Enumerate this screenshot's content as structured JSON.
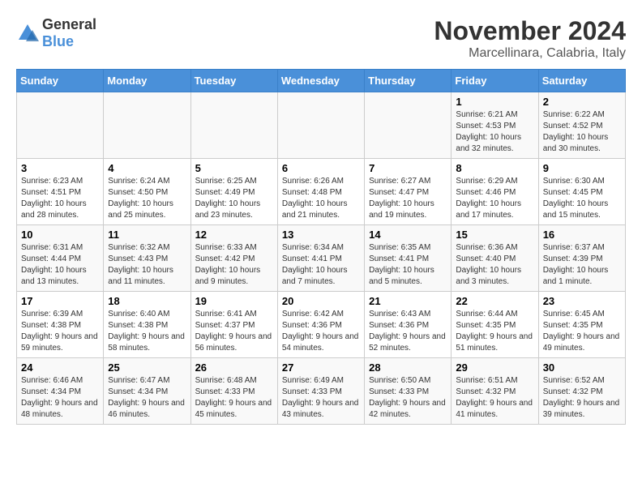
{
  "logo": {
    "general": "General",
    "blue": "Blue"
  },
  "title": "November 2024",
  "subtitle": "Marcellinara, Calabria, Italy",
  "headers": [
    "Sunday",
    "Monday",
    "Tuesday",
    "Wednesday",
    "Thursday",
    "Friday",
    "Saturday"
  ],
  "weeks": [
    [
      {
        "day": "",
        "detail": ""
      },
      {
        "day": "",
        "detail": ""
      },
      {
        "day": "",
        "detail": ""
      },
      {
        "day": "",
        "detail": ""
      },
      {
        "day": "",
        "detail": ""
      },
      {
        "day": "1",
        "detail": "Sunrise: 6:21 AM\nSunset: 4:53 PM\nDaylight: 10 hours and 32 minutes."
      },
      {
        "day": "2",
        "detail": "Sunrise: 6:22 AM\nSunset: 4:52 PM\nDaylight: 10 hours and 30 minutes."
      }
    ],
    [
      {
        "day": "3",
        "detail": "Sunrise: 6:23 AM\nSunset: 4:51 PM\nDaylight: 10 hours and 28 minutes."
      },
      {
        "day": "4",
        "detail": "Sunrise: 6:24 AM\nSunset: 4:50 PM\nDaylight: 10 hours and 25 minutes."
      },
      {
        "day": "5",
        "detail": "Sunrise: 6:25 AM\nSunset: 4:49 PM\nDaylight: 10 hours and 23 minutes."
      },
      {
        "day": "6",
        "detail": "Sunrise: 6:26 AM\nSunset: 4:48 PM\nDaylight: 10 hours and 21 minutes."
      },
      {
        "day": "7",
        "detail": "Sunrise: 6:27 AM\nSunset: 4:47 PM\nDaylight: 10 hours and 19 minutes."
      },
      {
        "day": "8",
        "detail": "Sunrise: 6:29 AM\nSunset: 4:46 PM\nDaylight: 10 hours and 17 minutes."
      },
      {
        "day": "9",
        "detail": "Sunrise: 6:30 AM\nSunset: 4:45 PM\nDaylight: 10 hours and 15 minutes."
      }
    ],
    [
      {
        "day": "10",
        "detail": "Sunrise: 6:31 AM\nSunset: 4:44 PM\nDaylight: 10 hours and 13 minutes."
      },
      {
        "day": "11",
        "detail": "Sunrise: 6:32 AM\nSunset: 4:43 PM\nDaylight: 10 hours and 11 minutes."
      },
      {
        "day": "12",
        "detail": "Sunrise: 6:33 AM\nSunset: 4:42 PM\nDaylight: 10 hours and 9 minutes."
      },
      {
        "day": "13",
        "detail": "Sunrise: 6:34 AM\nSunset: 4:41 PM\nDaylight: 10 hours and 7 minutes."
      },
      {
        "day": "14",
        "detail": "Sunrise: 6:35 AM\nSunset: 4:41 PM\nDaylight: 10 hours and 5 minutes."
      },
      {
        "day": "15",
        "detail": "Sunrise: 6:36 AM\nSunset: 4:40 PM\nDaylight: 10 hours and 3 minutes."
      },
      {
        "day": "16",
        "detail": "Sunrise: 6:37 AM\nSunset: 4:39 PM\nDaylight: 10 hours and 1 minute."
      }
    ],
    [
      {
        "day": "17",
        "detail": "Sunrise: 6:39 AM\nSunset: 4:38 PM\nDaylight: 9 hours and 59 minutes."
      },
      {
        "day": "18",
        "detail": "Sunrise: 6:40 AM\nSunset: 4:38 PM\nDaylight: 9 hours and 58 minutes."
      },
      {
        "day": "19",
        "detail": "Sunrise: 6:41 AM\nSunset: 4:37 PM\nDaylight: 9 hours and 56 minutes."
      },
      {
        "day": "20",
        "detail": "Sunrise: 6:42 AM\nSunset: 4:36 PM\nDaylight: 9 hours and 54 minutes."
      },
      {
        "day": "21",
        "detail": "Sunrise: 6:43 AM\nSunset: 4:36 PM\nDaylight: 9 hours and 52 minutes."
      },
      {
        "day": "22",
        "detail": "Sunrise: 6:44 AM\nSunset: 4:35 PM\nDaylight: 9 hours and 51 minutes."
      },
      {
        "day": "23",
        "detail": "Sunrise: 6:45 AM\nSunset: 4:35 PM\nDaylight: 9 hours and 49 minutes."
      }
    ],
    [
      {
        "day": "24",
        "detail": "Sunrise: 6:46 AM\nSunset: 4:34 PM\nDaylight: 9 hours and 48 minutes."
      },
      {
        "day": "25",
        "detail": "Sunrise: 6:47 AM\nSunset: 4:34 PM\nDaylight: 9 hours and 46 minutes."
      },
      {
        "day": "26",
        "detail": "Sunrise: 6:48 AM\nSunset: 4:33 PM\nDaylight: 9 hours and 45 minutes."
      },
      {
        "day": "27",
        "detail": "Sunrise: 6:49 AM\nSunset: 4:33 PM\nDaylight: 9 hours and 43 minutes."
      },
      {
        "day": "28",
        "detail": "Sunrise: 6:50 AM\nSunset: 4:33 PM\nDaylight: 9 hours and 42 minutes."
      },
      {
        "day": "29",
        "detail": "Sunrise: 6:51 AM\nSunset: 4:32 PM\nDaylight: 9 hours and 41 minutes."
      },
      {
        "day": "30",
        "detail": "Sunrise: 6:52 AM\nSunset: 4:32 PM\nDaylight: 9 hours and 39 minutes."
      }
    ]
  ]
}
